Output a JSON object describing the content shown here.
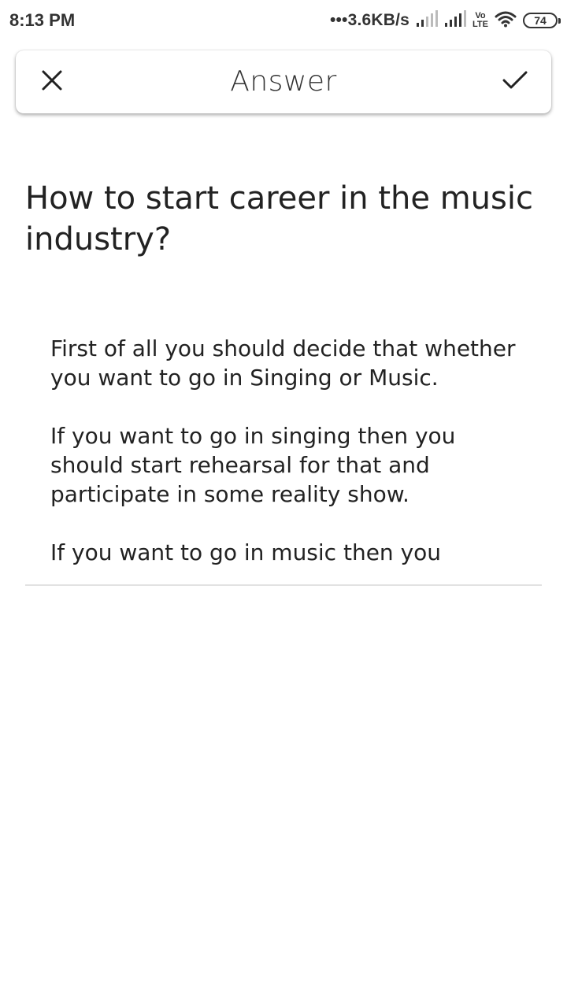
{
  "status_bar": {
    "time": "8:13 PM",
    "net_speed": "•••3.6KB/s",
    "volte_top": "Vo",
    "volte_bottom": "LTE",
    "battery": "74"
  },
  "toolbar": {
    "title": "Answer",
    "close_icon": "close-icon",
    "confirm_icon": "check-icon"
  },
  "question": {
    "text": "How to start career in the music industry?"
  },
  "answer": {
    "paragraphs": [
      "First of all you should decide that whether you want to go in Singing or Music.",
      "If you want to go in singing then you should start rehearsal for that and participate in some reality show.",
      "If you want to go in music then you"
    ]
  },
  "colors": {
    "text": "#222222",
    "background": "#ffffff",
    "divider": "#e2e2e2"
  }
}
